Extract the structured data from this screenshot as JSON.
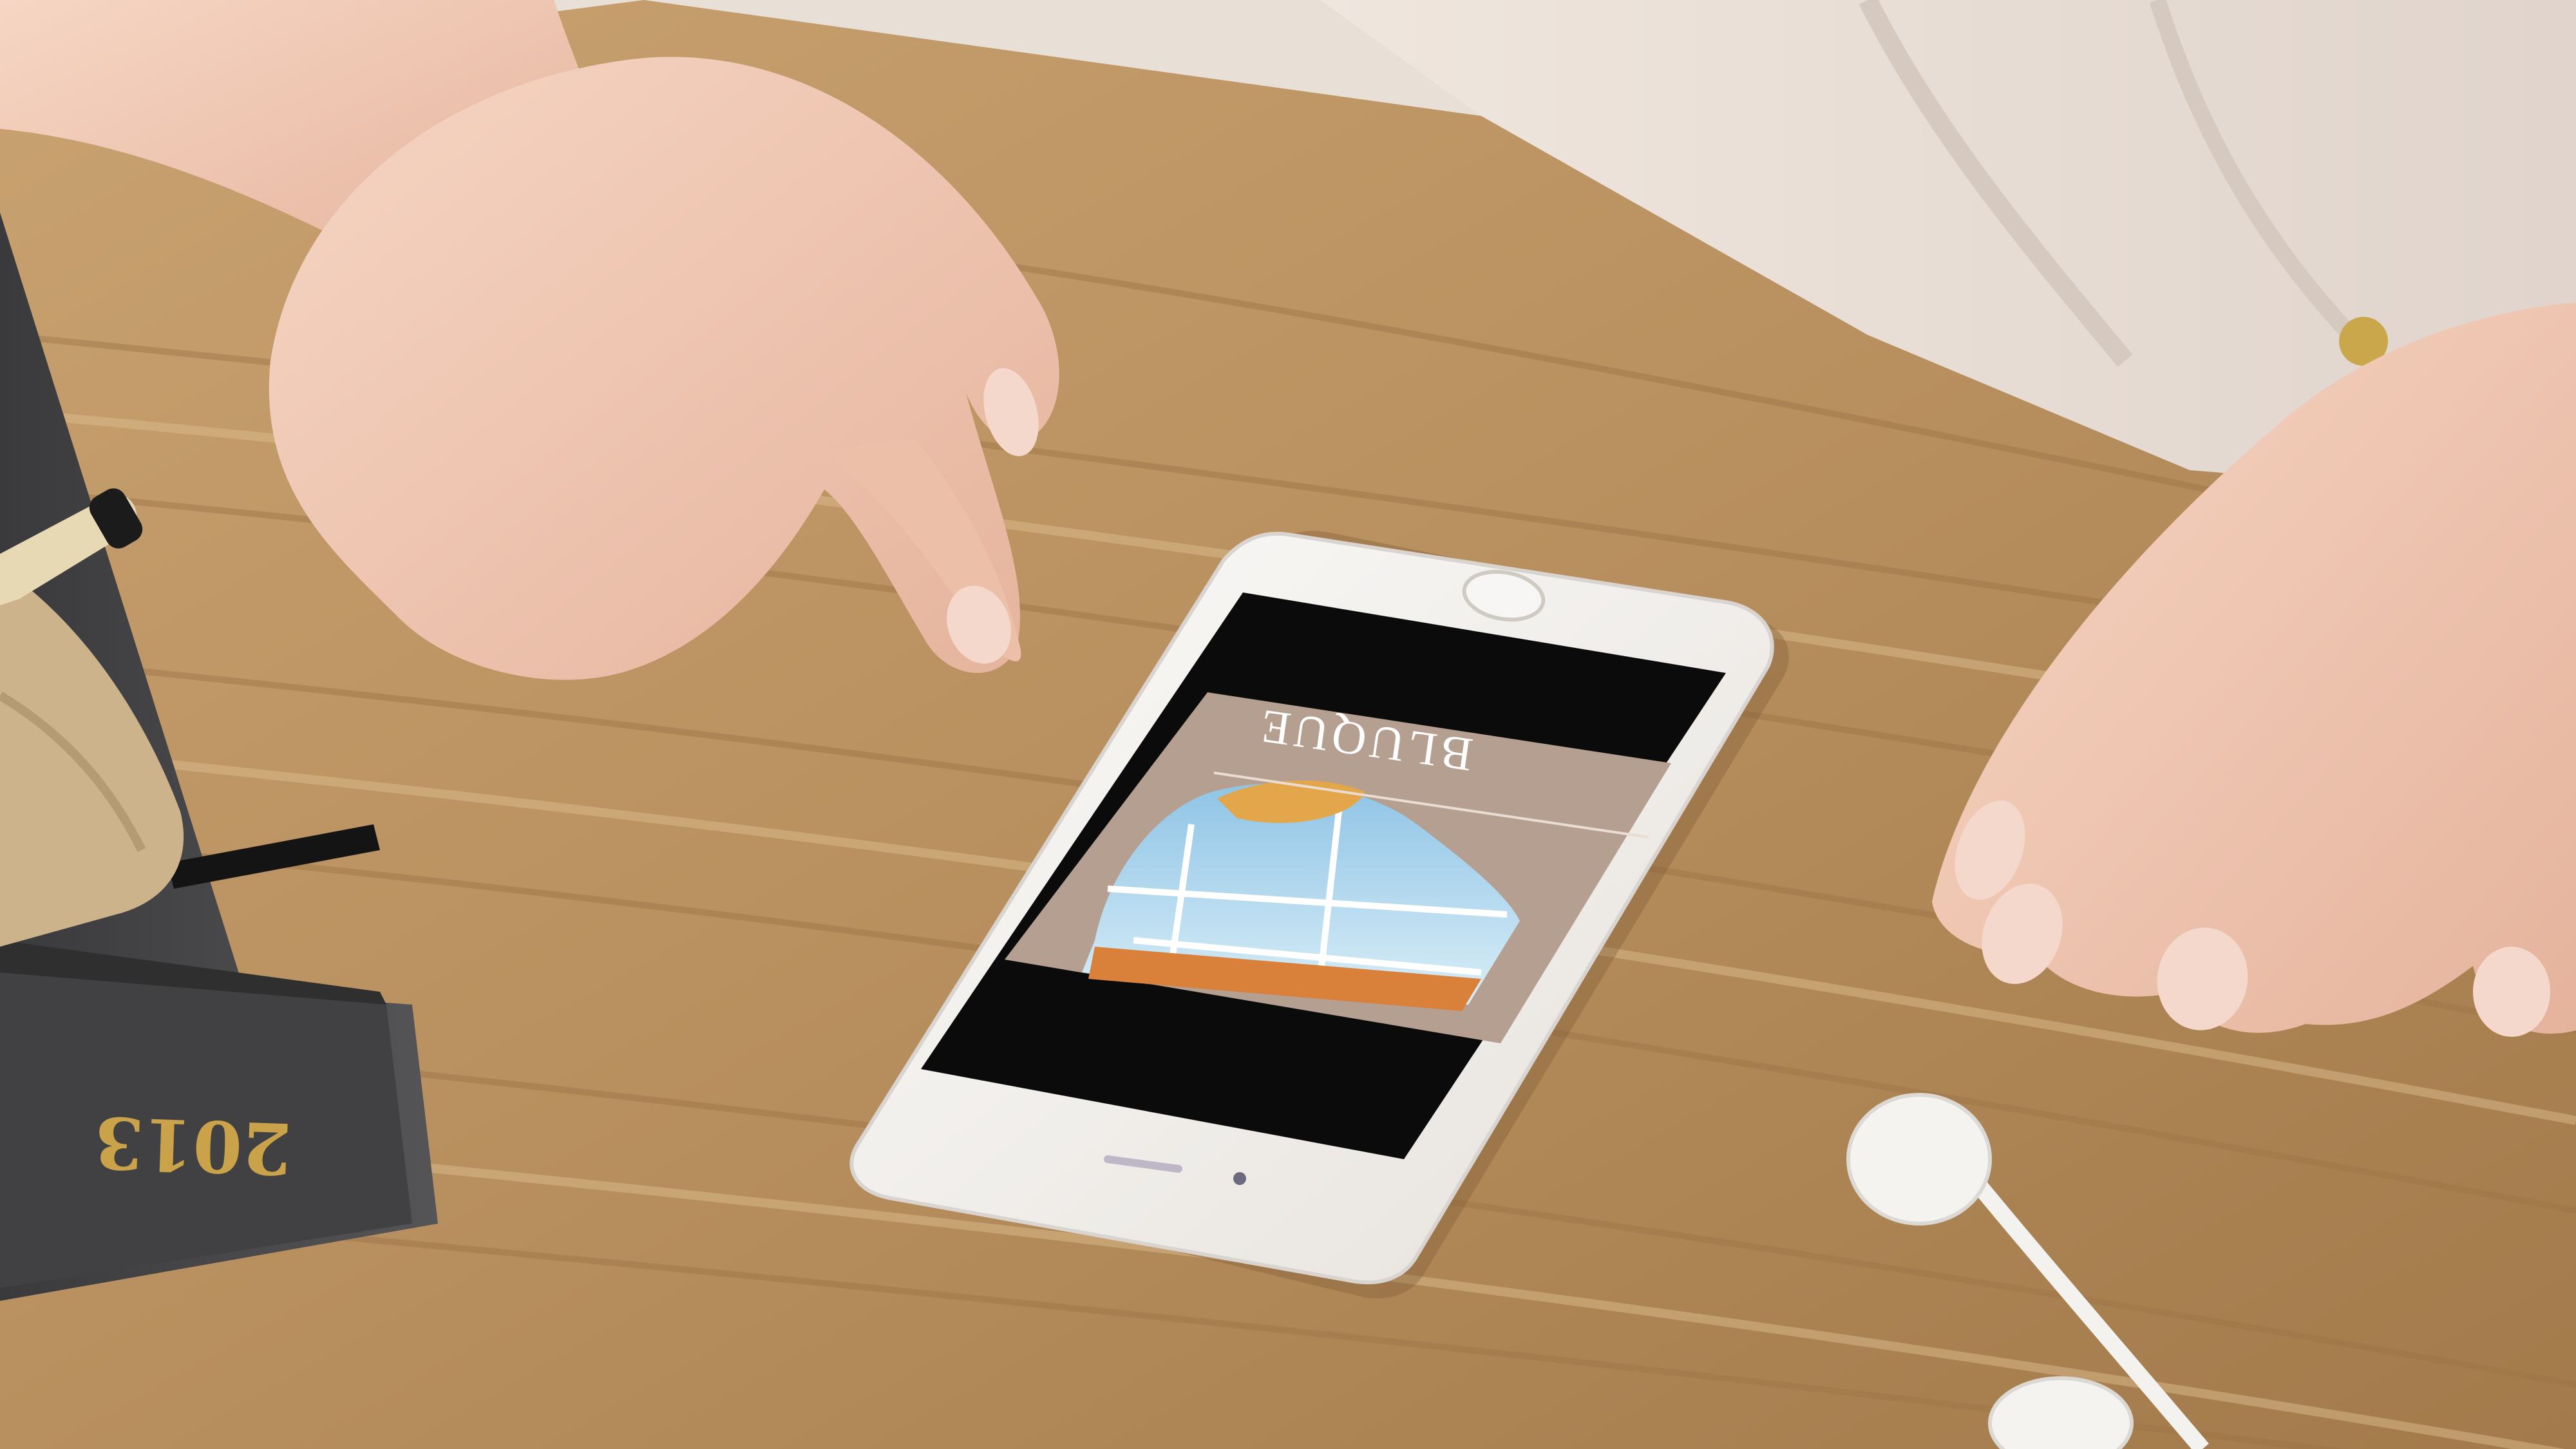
{
  "scene": {
    "description_free": true,
    "phone": {
      "screen": {
        "brand_text": "BLUQUE",
        "brand_color": "#ffffff",
        "panel_color": "#b49f90",
        "bezel_color": "#0b0b0b"
      }
    },
    "book": {
      "spine_text": "2013",
      "spine_text_color": "#caa24a",
      "cover_color": "#4a4a4c"
    },
    "colors": {
      "desk_base": "#b48b5a",
      "desk_light": "#d2ae7f",
      "sleeve": "#ece4dc",
      "skin": "#efc7b2",
      "phone_body": "#f3f1ee"
    }
  }
}
